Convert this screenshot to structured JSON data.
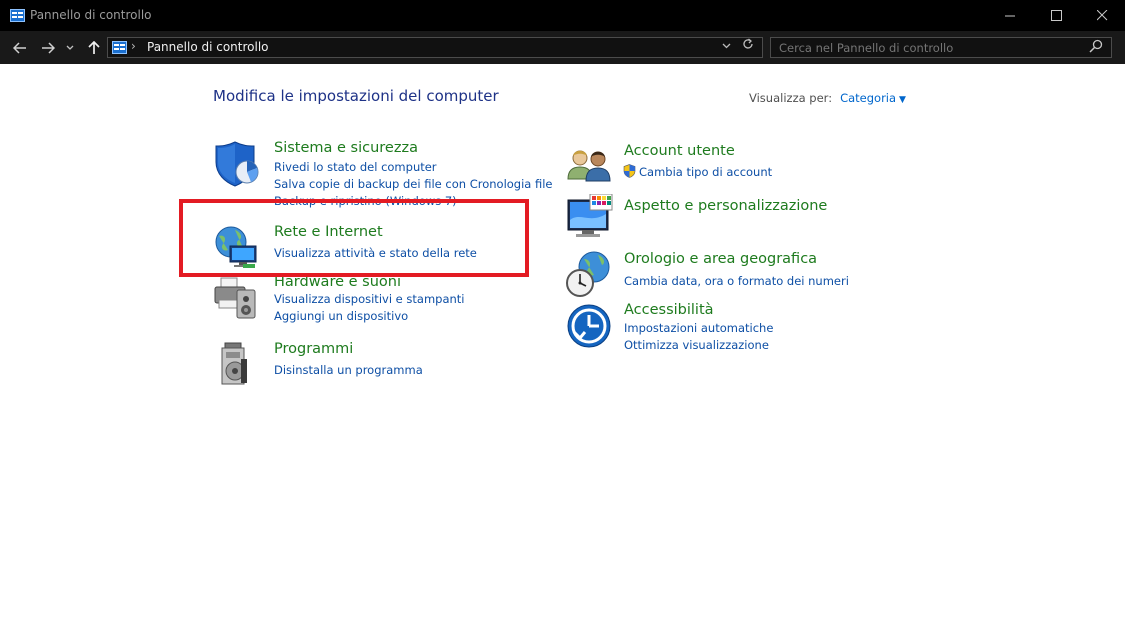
{
  "window": {
    "title": "Pannello di controllo",
    "minimize_icon": "minimize-icon",
    "maximize_icon": "maximize-icon",
    "close_icon": "close-icon"
  },
  "nav": {
    "breadcrumb": "Pannello di controllo",
    "search_placeholder": "Cerca nel Pannello di controllo"
  },
  "main": {
    "title": "Modifica le impostazioni del computer",
    "view_by_label": "Visualizza per:",
    "view_by_value": "Categoria"
  },
  "categories_left": [
    {
      "heading": "Sistema e sicurezza",
      "icon": "security-shield-icon",
      "links": [
        "Rivedi lo stato del computer",
        "Salva copie di backup dei file con Cronologia file",
        "Backup e ripristino (Windows 7)"
      ]
    },
    {
      "heading": "Rete e Internet",
      "icon": "network-globe-icon",
      "links": [
        "Visualizza attività e stato della rete"
      ]
    },
    {
      "heading": "Hardware e suoni",
      "icon": "printer-speaker-icon",
      "links": [
        "Visualizza dispositivi e stampanti",
        "Aggiungi un dispositivo"
      ]
    },
    {
      "heading": "Programmi",
      "icon": "programs-disc-icon",
      "links": [
        "Disinstalla un programma"
      ]
    }
  ],
  "categories_right": [
    {
      "heading": "Account utente",
      "icon": "users-icon",
      "links": [
        "Cambia tipo di account"
      ]
    },
    {
      "heading": "Aspetto e personalizzazione",
      "icon": "monitor-palette-icon",
      "links": []
    },
    {
      "heading": "Orologio e area geografica",
      "icon": "clock-globe-icon",
      "links": [
        "Cambia data, ora o formato dei numeri"
      ]
    },
    {
      "heading": "Accessibilità",
      "icon": "accessibility-icon",
      "links": [
        "Impostazioni automatiche",
        "Ottimizza visualizzazione"
      ]
    }
  ],
  "colors": {
    "heading_green": "#1e7b1e",
    "link_blue": "#0e4fa5",
    "title_blue": "#1e3287",
    "highlight_red": "#e31b23",
    "titlebar": "#000000"
  }
}
